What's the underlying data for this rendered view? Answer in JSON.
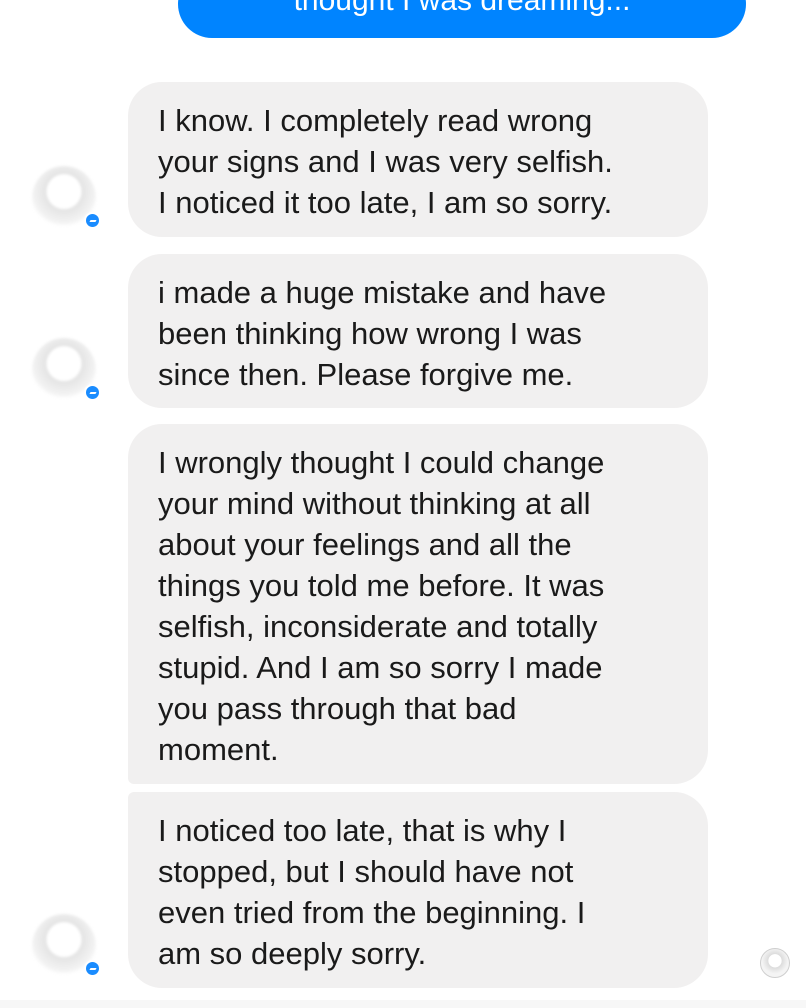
{
  "conversation": {
    "outgoing_message": "thought I was dreaming...",
    "messages": [
      {
        "lines": [
          "I know. I completely read wrong",
          "your signs and I was very selfish.",
          "I noticed it too late, I am so sorry."
        ]
      },
      {
        "lines": [
          "i made a huge mistake and have",
          "been thinking how wrong I was",
          "since then. Please forgive me."
        ]
      },
      {
        "lines": [
          "I wrongly thought I could change",
          "your mind without thinking at all",
          "about your feelings and all the",
          "things you told me before. It was",
          "selfish, inconsiderate and totally",
          "stupid. And I am so sorry I made",
          "you pass through that bad",
          "moment."
        ]
      },
      {
        "lines": [
          "I noticed too late, that is why I",
          "stopped, but I should have not",
          "even tried from the beginning. I",
          "am so deeply sorry."
        ]
      }
    ]
  },
  "icons": {
    "avatar": "blurred-contact-avatar",
    "badge": "messenger-badge-icon",
    "read_receipt": "read-receipt-avatar-icon"
  },
  "colors": {
    "outgoing_bubble": "#0084ff",
    "incoming_bubble": "#f1f0f0",
    "badge": "#1a8cff"
  }
}
